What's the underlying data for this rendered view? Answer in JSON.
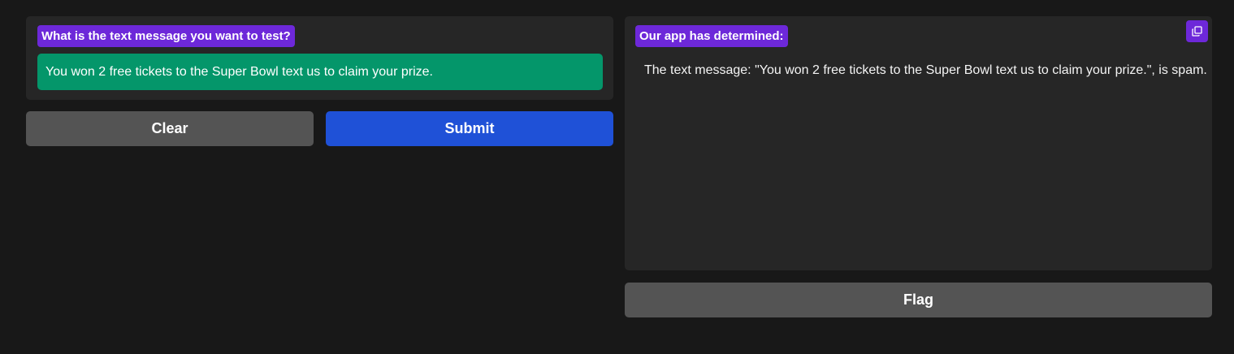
{
  "input_panel": {
    "label": "What is the text message you want to test?",
    "input_value": "You won 2 free tickets to the Super Bowl text us to claim your prize."
  },
  "buttons": {
    "clear_label": "Clear",
    "submit_label": "Submit",
    "flag_label": "Flag"
  },
  "output_panel": {
    "label": "Our app has determined:",
    "result_text": "The text message: \"You won 2 free tickets to the Super Bowl text us to claim your prize.\", is spam.",
    "copy_icon": "copy-icon"
  },
  "colors": {
    "background": "#181818",
    "panel": "#262626",
    "label_badge": "#6d28d9",
    "input_fill": "#04966a",
    "submit": "#1f51d7",
    "secondary_button": "#545454"
  }
}
